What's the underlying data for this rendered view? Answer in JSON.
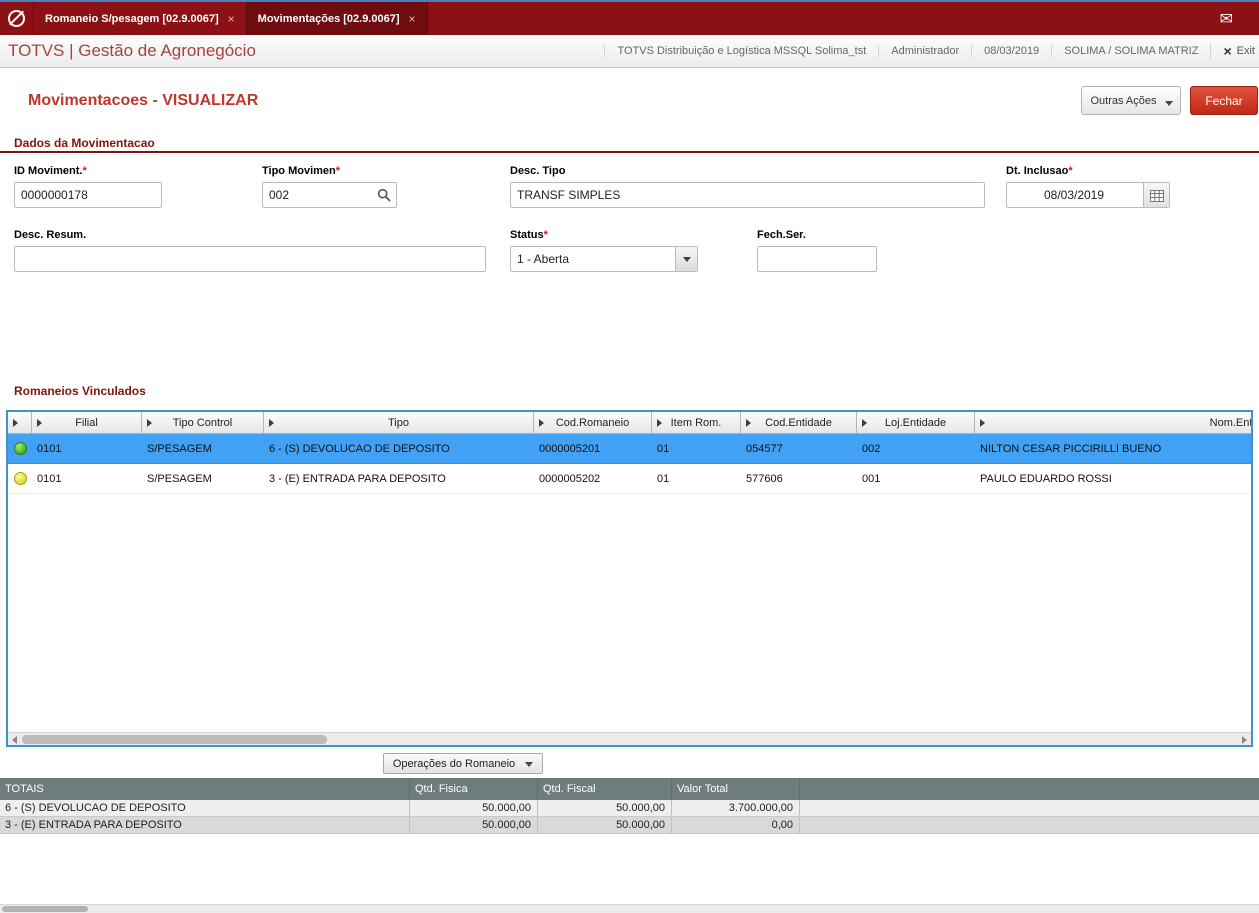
{
  "titlebar": {
    "tabs": [
      {
        "label": "Romaneio S/pesagem [02.9.0067]",
        "active": false
      },
      {
        "label": "Movimentações [02.9.0067]",
        "active": true
      }
    ]
  },
  "header": {
    "brand": "TOTVS | Gestão de Agronegócio",
    "context": [
      "TOTVS Distribuição e Logística MSSQL Solima_tst",
      "Administrador",
      "08/03/2019",
      "SOLIMA / SOLIMA MATRIZ"
    ],
    "exit_label": "Exit"
  },
  "page": {
    "title": "Movimentacoes - VISUALIZAR",
    "outras_acoes_label": "Outras Ações",
    "fechar_label": "Fechar"
  },
  "form": {
    "section_title": "Dados da Movimentacao",
    "required_marker": "*",
    "id_moviment": {
      "label": "ID Moviment.",
      "value": "0000000178"
    },
    "tipo_movimen": {
      "label": "Tipo Movimen",
      "value": "002"
    },
    "desc_tipo": {
      "label": "Desc. Tipo",
      "value": "TRANSF SIMPLES"
    },
    "dt_inclusao": {
      "label": "Dt. Inclusao",
      "value": "08/03/2019"
    },
    "desc_resum": {
      "label": "Desc. Resum.",
      "value": ""
    },
    "status": {
      "label": "Status",
      "value": "1 - Aberta"
    },
    "fech_ser": {
      "label": "Fech.Ser.",
      "value": ""
    }
  },
  "romaneios": {
    "section_title": "Romaneios Vinculados",
    "columns": [
      "Filial",
      "Tipo Control",
      "Tipo",
      "Cod.Romaneio",
      "Item Rom.",
      "Cod.Entidade",
      "Loj.Entidade",
      "Nom.Entidade"
    ],
    "rows": [
      {
        "status": "green",
        "selected": true,
        "cells": [
          "0101",
          "S/PESAGEM",
          "6 - (S) DEVOLUCAO DE DEPOSITO",
          "0000005201",
          "01",
          "054577",
          "002",
          "NILTON CESAR PICCIRILLI BUENO"
        ]
      },
      {
        "status": "yellow",
        "selected": false,
        "cells": [
          "0101",
          "S/PESAGEM",
          "3 - (E) ENTRADA PARA DEPOSITO",
          "0000005202",
          "01",
          "577606",
          "001",
          "PAULO EDUARDO ROSSI"
        ]
      }
    ],
    "operations_button": "Operações do Romaneio"
  },
  "totals": {
    "header": [
      "TOTAIS",
      "Qtd. Fisica",
      "Qtd. Fiscal",
      "Valor Total"
    ],
    "rows": [
      [
        "6 - (S) DEVOLUCAO DE DEPOSITO",
        "50.000,00",
        "50.000,00",
        "3.700.000,00"
      ],
      [
        "3 - (E) ENTRADA PARA DEPOSITO",
        "50.000,00",
        "50.000,00",
        "0,00"
      ]
    ]
  },
  "icons": {
    "mail": "✉",
    "tab_close": "×",
    "exit_x": "×"
  },
  "colors": {
    "titlebar": "#8C1115",
    "titlebar_active_tab": "#6E0C10",
    "brand_red": "#A5423B",
    "accent_red": "#BE372A",
    "selection_blue": "#41A1F4",
    "grid_border_blue": "#4490C8",
    "totals_header": "#6E7C7C",
    "status_green": "#3FAE1F",
    "status_yellow": "#E0D92B",
    "fechar_button": "#C02A18"
  }
}
